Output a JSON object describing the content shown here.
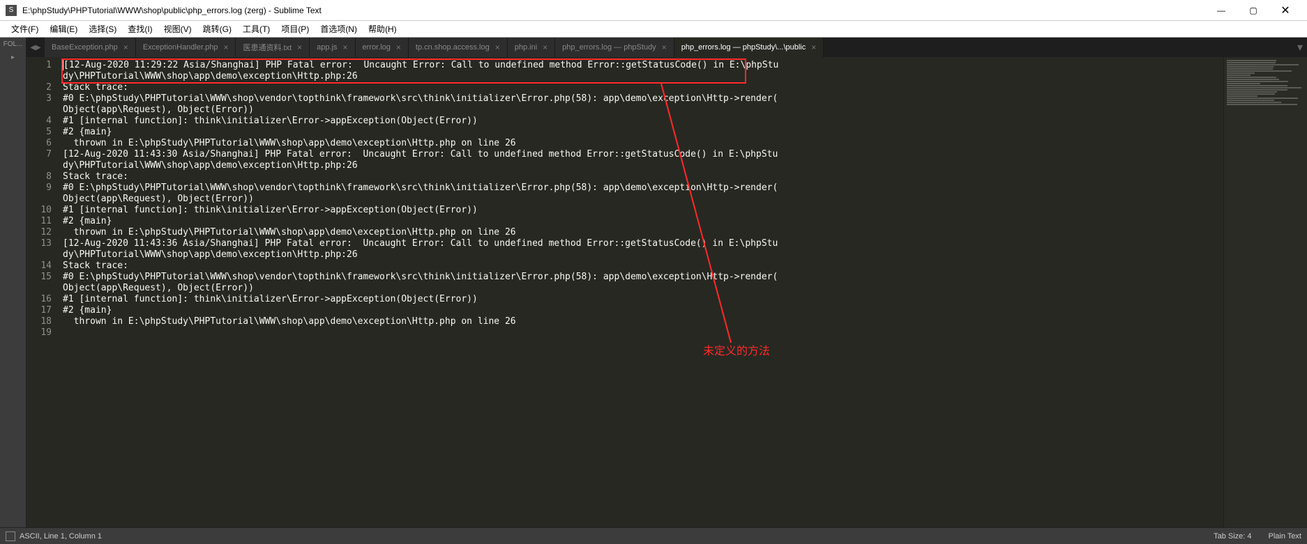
{
  "window": {
    "title": "E:\\phpStudy\\PHPTutorial\\WWW\\shop\\public\\php_errors.log (zerg) - Sublime Text"
  },
  "menu": {
    "file": "文件(F)",
    "edit": "编辑(E)",
    "select": "选择(S)",
    "find": "查找(I)",
    "view": "视图(V)",
    "goto": "跳转(G)",
    "tools": "工具(T)",
    "project": "项目(P)",
    "preferences": "首选项(N)",
    "help": "帮助(H)"
  },
  "sidebar": {
    "folders_label": "FOL..."
  },
  "tabs": [
    {
      "label": "BaseException.php",
      "active": false
    },
    {
      "label": "ExceptionHandler.php",
      "active": false
    },
    {
      "label": "医患通资料.txt",
      "active": false
    },
    {
      "label": "app.js",
      "active": false
    },
    {
      "label": "error.log",
      "active": false
    },
    {
      "label": "tp.cn.shop.access.log",
      "active": false
    },
    {
      "label": "php.ini",
      "active": false
    },
    {
      "label": "php_errors.log — phpStudy",
      "active": false
    },
    {
      "label": "php_errors.log — phpStudy\\...\\public",
      "active": true
    }
  ],
  "code": {
    "lines": [
      "[12-Aug-2020 11:29:22 Asia/Shanghai] PHP Fatal error:  Uncaught Error: Call to undefined method Error::getStatusCode() in E:\\phpStudy\\PHPTutorial\\WWW\\shop\\app\\demo\\exception\\Http.php:26",
      "Stack trace:",
      "#0 E:\\phpStudy\\PHPTutorial\\WWW\\shop\\vendor\\topthink\\framework\\src\\think\\initializer\\Error.php(58): app\\demo\\exception\\Http->render(Object(app\\Request), Object(Error))",
      "#1 [internal function]: think\\initializer\\Error->appException(Object(Error))",
      "#2 {main}",
      "  thrown in E:\\phpStudy\\PHPTutorial\\WWW\\shop\\app\\demo\\exception\\Http.php on line 26",
      "[12-Aug-2020 11:43:30 Asia/Shanghai] PHP Fatal error:  Uncaught Error: Call to undefined method Error::getStatusCode() in E:\\phpStudy\\PHPTutorial\\WWW\\shop\\app\\demo\\exception\\Http.php:26",
      "Stack trace:",
      "#0 E:\\phpStudy\\PHPTutorial\\WWW\\shop\\vendor\\topthink\\framework\\src\\think\\initializer\\Error.php(58): app\\demo\\exception\\Http->render(Object(app\\Request), Object(Error))",
      "#1 [internal function]: think\\initializer\\Error->appException(Object(Error))",
      "#2 {main}",
      "  thrown in E:\\phpStudy\\PHPTutorial\\WWW\\shop\\app\\demo\\exception\\Http.php on line 26",
      "[12-Aug-2020 11:43:36 Asia/Shanghai] PHP Fatal error:  Uncaught Error: Call to undefined method Error::getStatusCode() in E:\\phpStudy\\PHPTutorial\\WWW\\shop\\app\\demo\\exception\\Http.php:26",
      "Stack trace:",
      "#0 E:\\phpStudy\\PHPTutorial\\WWW\\shop\\vendor\\topthink\\framework\\src\\think\\initializer\\Error.php(58): app\\demo\\exception\\Http->render(Object(app\\Request), Object(Error))",
      "#1 [internal function]: think\\initializer\\Error->appException(Object(Error))",
      "#2 {main}",
      "  thrown in E:\\phpStudy\\PHPTutorial\\WWW\\shop\\app\\demo\\exception\\Http.php on line 26",
      ""
    ],
    "line_count": 19
  },
  "annotation": {
    "text": "未定义的方法"
  },
  "status": {
    "position": "ASCII, Line 1, Column 1",
    "tab_size": "Tab Size: 4",
    "syntax": "Plain Text"
  }
}
